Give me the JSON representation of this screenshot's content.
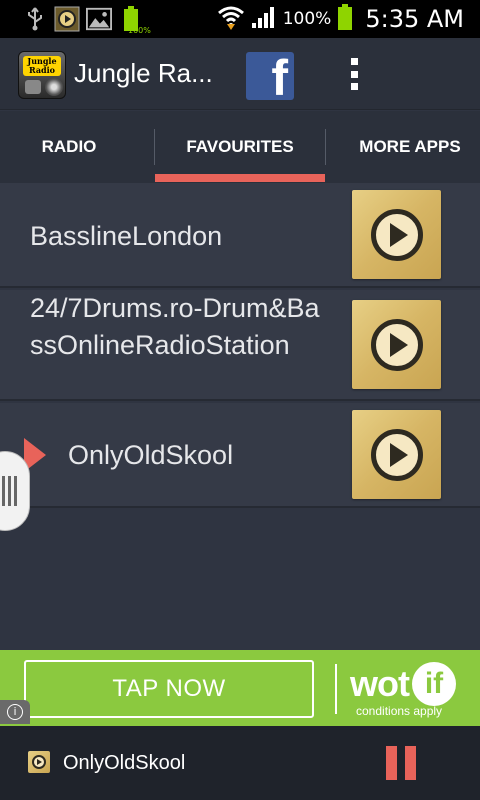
{
  "status_bar": {
    "battery_small_label": "100%",
    "battery_percent": "100%",
    "time": "5:35 AM",
    "icons": [
      "usb-icon",
      "media-play-icon",
      "gallery-icon",
      "battery-full-icon",
      "wifi-icon",
      "signal-icon",
      "battery-icon"
    ]
  },
  "action_bar": {
    "title": "Jungle Ra...",
    "logo_text": "Jungle Radio",
    "facebook_label": "f"
  },
  "tabs": [
    {
      "label": "RADIO",
      "selected": false
    },
    {
      "label": "FAVOURITES",
      "selected": true
    },
    {
      "label": "MORE APPS",
      "selected": false
    }
  ],
  "stations": [
    {
      "name": "BasslineLondon",
      "playing": false
    },
    {
      "name": "24/7Drums.ro-Drum&BassOnlineRadioStation",
      "playing": false
    },
    {
      "name": "OnlyOldSkool",
      "playing": true
    }
  ],
  "ad": {
    "cta": "TAP NOW",
    "brand_wot": "wot",
    "brand_if": "if",
    "subtext": "conditions apply",
    "info": "i"
  },
  "player": {
    "title": "OnlyOldSkool"
  },
  "colors": {
    "accent": "#e8635a",
    "ad_green": "#8bc93f",
    "background": "#2f3441",
    "play_gold": "#d6b564"
  }
}
